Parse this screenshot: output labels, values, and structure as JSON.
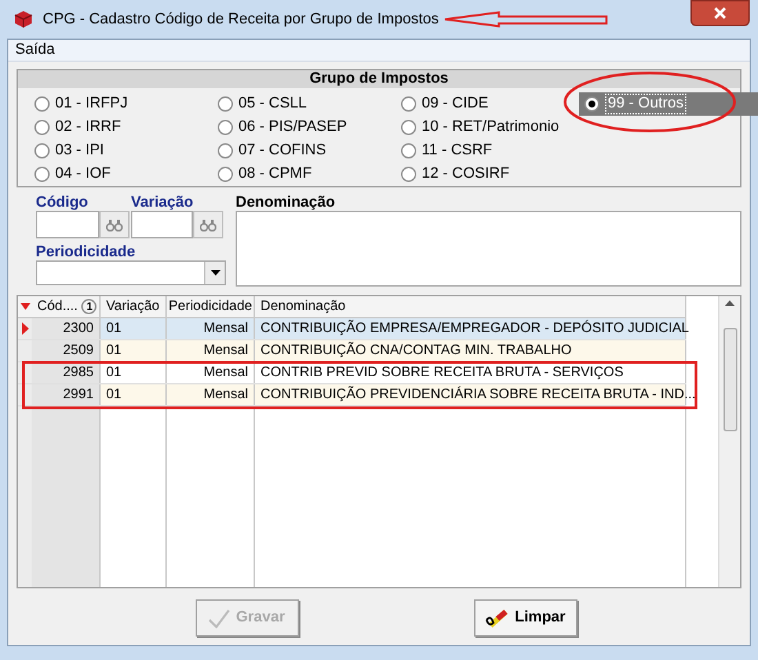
{
  "window": {
    "title": "CPG - Cadastro Código de Receita por Grupo de Impostos"
  },
  "menu": [
    "Saída"
  ],
  "group": {
    "title": "Grupo de Impostos",
    "radios": [
      {
        "label": "01 - IRFPJ",
        "selected": false
      },
      {
        "label": "02 - IRRF",
        "selected": false
      },
      {
        "label": "03 - IPI",
        "selected": false
      },
      {
        "label": "04 - IOF",
        "selected": false
      },
      {
        "label": "05 - CSLL",
        "selected": false
      },
      {
        "label": "06 - PIS/PASEP",
        "selected": false
      },
      {
        "label": "07 - COFINS",
        "selected": false
      },
      {
        "label": "08 - CPMF",
        "selected": false
      },
      {
        "label": "09 - CIDE",
        "selected": false
      },
      {
        "label": "10 - RET/Patrimonio",
        "selected": false
      },
      {
        "label": "11 - CSRF",
        "selected": false
      },
      {
        "label": "12 - COSIRF",
        "selected": false
      },
      {
        "label": "99 - Outros",
        "selected": true
      }
    ]
  },
  "fields": {
    "codigo": "Código",
    "variacao": "Variação",
    "periodicidade": "Periodicidade",
    "denominacao": "Denominação"
  },
  "table": {
    "columns": [
      "Cód....",
      "Variação",
      "Periodicidade",
      "Denominação"
    ],
    "sort_badge": "1",
    "rows": [
      {
        "cells": [
          "2300",
          "01",
          "Mensal",
          "CONTRIBUIÇÃO EMPRESA/EMPREGADOR - DEPÓSITO JUDICIAL"
        ],
        "selected": true
      },
      {
        "cells": [
          "2509",
          "01",
          "Mensal",
          "CONTRIBUIÇÃO CNA/CONTAG MIN. TRABALHO"
        ],
        "selected": false
      },
      {
        "cells": [
          "2985",
          "01",
          "Mensal",
          "CONTRIB PREVID SOBRE RECEITA BRUTA - SERVIÇOS"
        ],
        "selected": false
      },
      {
        "cells": [
          "2991",
          "01",
          "Mensal",
          "CONTRIBUIÇÃO PREVIDENCIÁRIA SOBRE RECEITA BRUTA - IND..."
        ],
        "selected": false
      }
    ]
  },
  "buttons": [
    {
      "label": "Gravar",
      "kind": "save",
      "disabled": true
    },
    {
      "label": "Limpar",
      "kind": "clear",
      "disabled": false
    }
  ]
}
